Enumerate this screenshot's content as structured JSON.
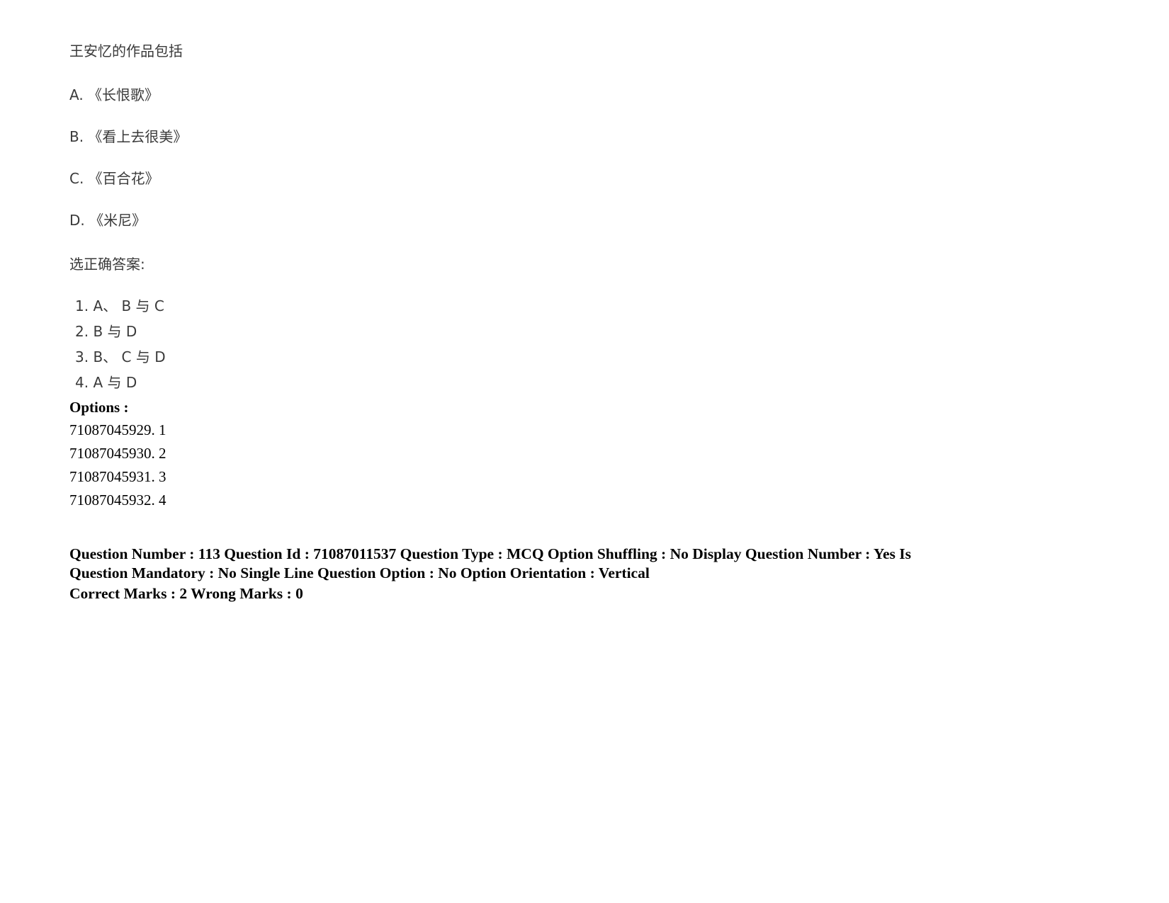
{
  "document": {
    "stem": "王安忆的作品包括",
    "choices": [
      {
        "label": "A.",
        "text": "《长恨歌》",
        "full": "A. 《长恨歌》"
      },
      {
        "label": "B.",
        "text": "《看上去很美》",
        "full": "B. 《看上去很美》"
      },
      {
        "label": "C.",
        "text": "《百合花》",
        "full": "C. 《百合花》"
      },
      {
        "label": "D.",
        "text": "《米尼》",
        "full": "D. 《米尼》"
      }
    ],
    "instruction": "选正确答案:",
    "answer_options": [
      {
        "number": "1.",
        "text": "A、 B 与 C",
        "full": "1. A、 B 与 C"
      },
      {
        "number": "2.",
        "text": "B 与 D",
        "full": "2. B 与 D"
      },
      {
        "number": "3.",
        "text": "B、 C 与 D",
        "full": "3. B、 C 与 D"
      },
      {
        "number": "4.",
        "text": "A 与 D",
        "full": "4. A 与 D"
      }
    ],
    "options_label": "Options :",
    "option_ids": [
      "71087045929. 1",
      "71087045930. 2",
      "71087045931. 3",
      "71087045932. 4"
    ],
    "metadata": {
      "line1": "Question Number : 113 Question Id : 71087011537 Question Type : MCQ Option Shuffling : No Display Question Number : Yes Is",
      "line2": "Question Mandatory : No Single Line Question Option : No Option Orientation : Vertical",
      "line3": "Correct Marks : 2 Wrong Marks : 0",
      "question_number": "113",
      "question_id": "71087011537",
      "question_type": "MCQ",
      "option_shuffling": "No",
      "display_question_number": "Yes",
      "is_question_mandatory": "No",
      "single_line_question_option": "No",
      "option_orientation": "Vertical",
      "correct_marks": "2",
      "wrong_marks": "0"
    }
  }
}
